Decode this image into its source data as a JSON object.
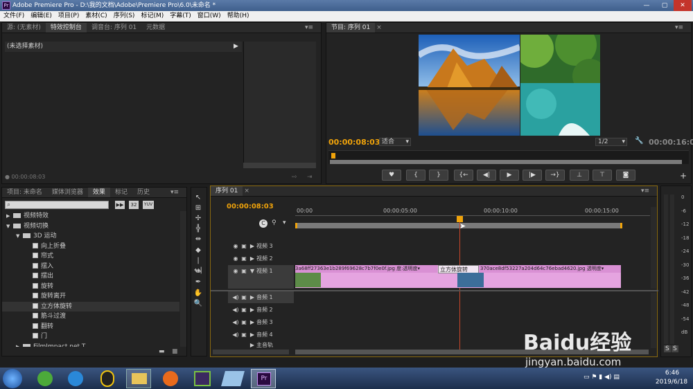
{
  "window": {
    "title": "Adobe Premiere Pro - D:\\我的文档\\Adobe\\Premiere Pro\\6.0\\未命名 *",
    "logo": "Pr"
  },
  "menu": [
    "文件(F)",
    "编辑(E)",
    "项目(P)",
    "素材(C)",
    "序列(S)",
    "标记(M)",
    "字幕(T)",
    "窗口(W)",
    "帮助(H)"
  ],
  "source_panel": {
    "tabs": [
      "源: (无素材)",
      "特效控制台",
      "调音台: 序列 01",
      "元数据"
    ],
    "active_tab": "特效控制台",
    "no_clip": "(未选择素材)",
    "timecode": "00:00:08:03"
  },
  "program_monitor": {
    "tab": "节目: 序列 01",
    "timecode": "00:00:08:03",
    "fit": "适合",
    "resolution": "1/2",
    "duration": "00:00:16:00",
    "controls": [
      "marker-icon",
      "in-point-icon",
      "out-point-icon",
      "goto-in-icon",
      "step-back-icon",
      "play-icon",
      "step-forward-icon",
      "goto-out-icon",
      "lift-icon",
      "extract-icon",
      "export-frame-icon"
    ]
  },
  "project_panel": {
    "tabs": [
      "项目: 未命名",
      "媒体浏览器",
      "效果",
      "标记",
      "历史"
    ],
    "active_tab": "效果",
    "buttons": [
      "32",
      "YUV"
    ],
    "tree": [
      {
        "label": "视频特效",
        "level": 0,
        "type": "folder",
        "open": false
      },
      {
        "label": "视频切换",
        "level": 0,
        "type": "folder",
        "open": true
      },
      {
        "label": "3D 运动",
        "level": 1,
        "type": "folder",
        "open": true
      },
      {
        "label": "向上折叠",
        "level": 2,
        "type": "effect"
      },
      {
        "label": "帘式",
        "level": 2,
        "type": "effect"
      },
      {
        "label": "摆入",
        "level": 2,
        "type": "effect"
      },
      {
        "label": "摆出",
        "level": 2,
        "type": "effect"
      },
      {
        "label": "旋转",
        "level": 2,
        "type": "effect"
      },
      {
        "label": "旋转离开",
        "level": 2,
        "type": "effect"
      },
      {
        "label": "立方体旋转",
        "level": 2,
        "type": "effect",
        "selected": true
      },
      {
        "label": "筋斗过渡",
        "level": 2,
        "type": "effect"
      },
      {
        "label": "翻转",
        "level": 2,
        "type": "effect"
      },
      {
        "label": "门",
        "level": 2,
        "type": "effect"
      },
      {
        "label": "FilmImpact.net T...",
        "level": 1,
        "type": "folder",
        "open": false
      }
    ]
  },
  "timeline": {
    "tab": "序列 01",
    "timecode": "00:00:08:03",
    "ruler": [
      "00:00",
      "00:00:05:00",
      "00:00:10:00",
      "00:00:15:00"
    ],
    "video_tracks": [
      "视频 3",
      "视频 2",
      "视频 1"
    ],
    "audio_tracks": [
      "音频 1",
      "音频 2",
      "音频 3",
      "音频 4"
    ],
    "master_track": "主音轨",
    "clips": {
      "clip1_name": "3a68ff27363e1b289f69628c7b7f0e0f.jpg",
      "clip1_fx": "度:透明度",
      "transition": "立方体旋转",
      "clip2_name": "370ace8df53227a204d64c76ebad4620.jpg",
      "clip2_fx": "透明度"
    }
  },
  "audio_meter": {
    "scale": [
      "0",
      "-6",
      "-12",
      "-18",
      "-24",
      "-30",
      "-36",
      "-42",
      "-48",
      "-54",
      "dB"
    ],
    "solo": [
      "S",
      "S"
    ]
  },
  "watermark": {
    "brand": "Baidu经验",
    "url": "jingyan.baidu.com"
  },
  "taskbar": {
    "clock_time": "6:46",
    "clock_date": "2019/6/18",
    "apps": [
      "start-orb-icon",
      "update-icon",
      "browser-icon",
      "qq-icon",
      "file-explorer-icon",
      "firefox-icon",
      "media-player-icon",
      "notepad-icon",
      "premiere-icon"
    ]
  },
  "colors": {
    "accent_timecode": "#f0a30a",
    "clip_pink": "#e5a4e0",
    "playhead": "#c8462a"
  }
}
